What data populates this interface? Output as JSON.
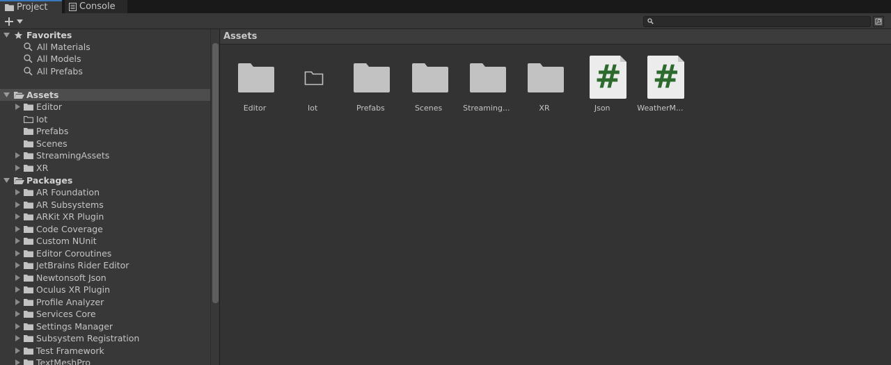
{
  "tabs": [
    {
      "label": "Project",
      "icon": "folder-icon",
      "active": true
    },
    {
      "label": "Console",
      "icon": "console-icon",
      "active": false
    }
  ],
  "toolbar": {
    "add_label": "+",
    "search_value": ""
  },
  "tree": {
    "favorites": {
      "label": "Favorites",
      "items": [
        "All Materials",
        "All Models",
        "All Prefabs"
      ]
    },
    "assets": {
      "label": "Assets",
      "items": [
        {
          "label": "Editor",
          "expandable": true,
          "empty": false
        },
        {
          "label": "Iot",
          "expandable": false,
          "empty": true
        },
        {
          "label": "Prefabs",
          "expandable": false,
          "empty": false
        },
        {
          "label": "Scenes",
          "expandable": false,
          "empty": false
        },
        {
          "label": "StreamingAssets",
          "expandable": true,
          "empty": false
        },
        {
          "label": "XR",
          "expandable": true,
          "empty": false
        }
      ]
    },
    "packages": {
      "label": "Packages",
      "items": [
        "AR Foundation",
        "AR Subsystems",
        "ARKit XR Plugin",
        "Code Coverage",
        "Custom NUnit",
        "Editor Coroutines",
        "JetBrains Rider Editor",
        "Newtonsoft Json",
        "Oculus XR Plugin",
        "Profile Analyzer",
        "Services Core",
        "Settings Manager",
        "Subsystem Registration",
        "Test Framework",
        "TextMeshPro"
      ]
    }
  },
  "grid": {
    "title": "Assets",
    "items": [
      {
        "label": "Editor",
        "type": "folder"
      },
      {
        "label": "Iot",
        "type": "empty-folder"
      },
      {
        "label": "Prefabs",
        "type": "folder"
      },
      {
        "label": "Scenes",
        "type": "folder"
      },
      {
        "label": "Streaming...",
        "type": "folder"
      },
      {
        "label": "XR",
        "type": "folder"
      },
      {
        "label": "Json",
        "type": "script"
      },
      {
        "label": "WeatherM...",
        "type": "script"
      }
    ]
  },
  "colors": {
    "accent": "#3a79bb",
    "script_hash": "#2d6a2d",
    "folder": "#c2c2c2"
  }
}
